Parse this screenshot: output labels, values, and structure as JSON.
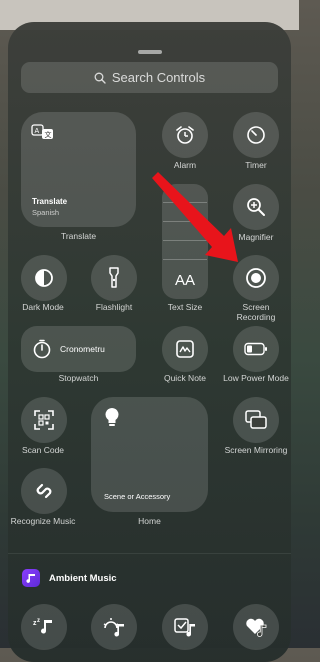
{
  "search": {
    "placeholder": "Search Controls",
    "icon": "search-icon"
  },
  "controls": {
    "translate": {
      "title": "Translate",
      "subtitle": "Spanish",
      "label": "Translate"
    },
    "alarm": {
      "label": "Alarm"
    },
    "timer": {
      "label": "Timer"
    },
    "magnifier": {
      "label": "Magnifier"
    },
    "text_size": {
      "label": "Text Size",
      "glyph": "AA"
    },
    "dark_mode": {
      "label": "Dark Mode"
    },
    "flashlight": {
      "label": "Flashlight"
    },
    "screen_recording": {
      "label": "Screen Recording"
    },
    "stopwatch": {
      "title": "Cronometru",
      "label": "Stopwatch"
    },
    "quick_note": {
      "label": "Quick Note"
    },
    "low_power": {
      "label": "Low Power Mode"
    },
    "scan_code": {
      "label": "Scan Code"
    },
    "home": {
      "title": "Scene or Accessory",
      "label": "Home"
    },
    "screen_mirroring": {
      "label": "Screen Mirroring"
    },
    "recognize_music": {
      "label": "Recognize Music"
    }
  },
  "ambient": {
    "title": "Ambient Music"
  },
  "colors": {
    "accent_red": "#e8141b",
    "music_purple": "#7a36f0"
  }
}
